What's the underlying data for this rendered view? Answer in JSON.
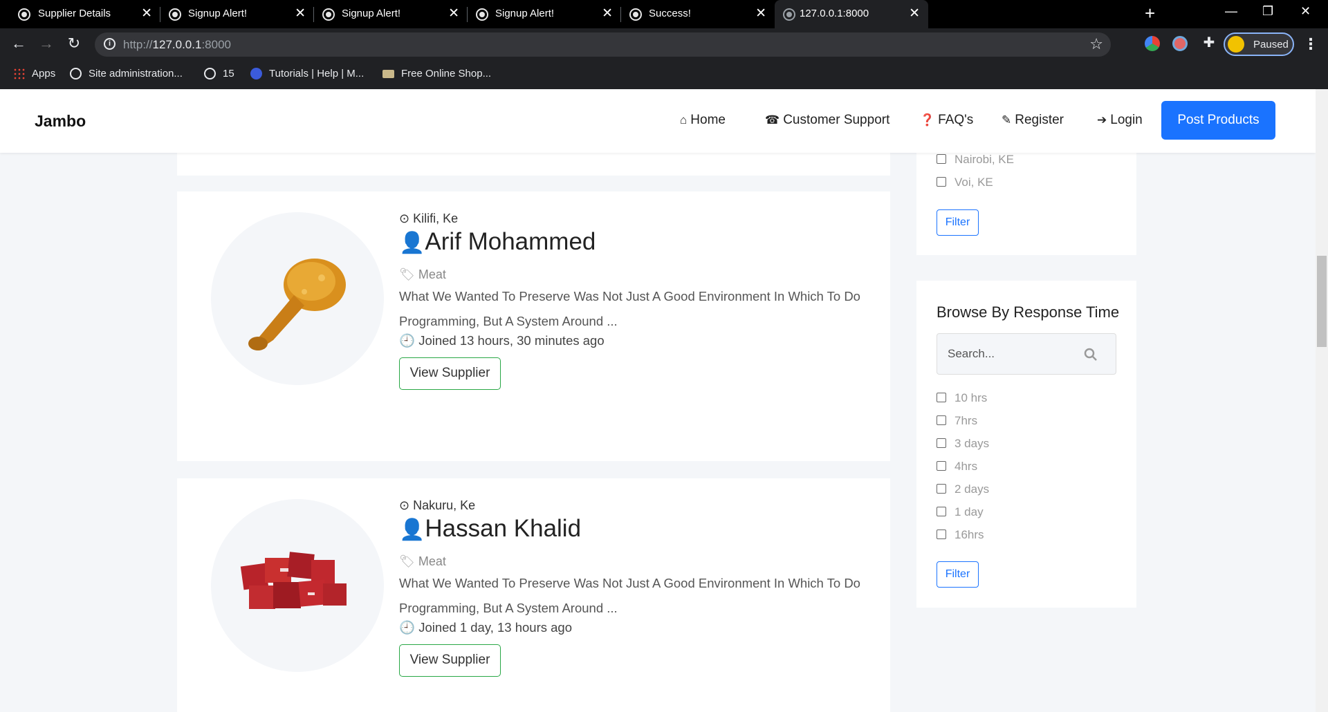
{
  "browser": {
    "tabs": [
      {
        "title": "Supplier Details"
      },
      {
        "title": "Signup Alert!"
      },
      {
        "title": "Signup Alert!"
      },
      {
        "title": "Signup Alert!"
      },
      {
        "title": "Success!"
      },
      {
        "title": "127.0.0.1:8000"
      }
    ],
    "url_prefix": "http://",
    "url_host": "127.0.0.1",
    "url_rest": ":8000",
    "profile_label": "Paused",
    "bookmarks": [
      {
        "label": "Apps",
        "icon": "apps-grid-icon"
      },
      {
        "label": "Site administration...",
        "icon": "globe-icon"
      },
      {
        "label": "15",
        "icon": "globe-icon"
      },
      {
        "label": "Tutorials | Help | M...",
        "icon": "tutorials-icon"
      },
      {
        "label": "Free Online Shop...",
        "icon": "shop-icon"
      }
    ]
  },
  "navbar": {
    "brand": "Jambo",
    "links": [
      {
        "label": "Home",
        "icon": "home-icon"
      },
      {
        "label": "Customer Support",
        "icon": "phone-icon"
      },
      {
        "label": "FAQ's",
        "icon": "question-icon"
      },
      {
        "label": "Register",
        "icon": "edit-icon"
      },
      {
        "label": "Login",
        "icon": "sign-in-icon"
      }
    ],
    "cta": "Post Products"
  },
  "suppliers": [
    {
      "location": "Kilifi, Ke",
      "name": "Arif Mohammed",
      "category": "Meat",
      "description": "What We Wanted To Preserve Was Not Just A Good Environment In Which To Do Programming, But A System Around ...",
      "joined": "Joined 13 hours, 30 minutes ago",
      "button": "View Supplier",
      "image": "fried-chicken-drumstick"
    },
    {
      "location": "Nakuru, Ke",
      "name": "Hassan Khalid",
      "category": "Meat",
      "description": "What We Wanted To Preserve Was Not Just A Good Environment In Which To Do Programming, But A System Around ...",
      "joined": "Joined 1 day, 13 hours ago",
      "button": "View Supplier",
      "image": "raw-beef-cubes"
    }
  ],
  "sidebar": {
    "location_filter": {
      "options": [
        "Nairobi, KE",
        "Voi, KE"
      ],
      "button": "Filter"
    },
    "response_filter": {
      "title": "Browse By Response Time",
      "search_placeholder": "Search...",
      "options": [
        "10 hrs",
        "7hrs",
        "3 days",
        "4hrs",
        "2 days",
        "1 day",
        "16hrs"
      ],
      "button": "Filter"
    }
  },
  "colors": {
    "primary": "#1a73ff",
    "success_border": "#28a745",
    "page_bg": "#f4f6f9"
  }
}
